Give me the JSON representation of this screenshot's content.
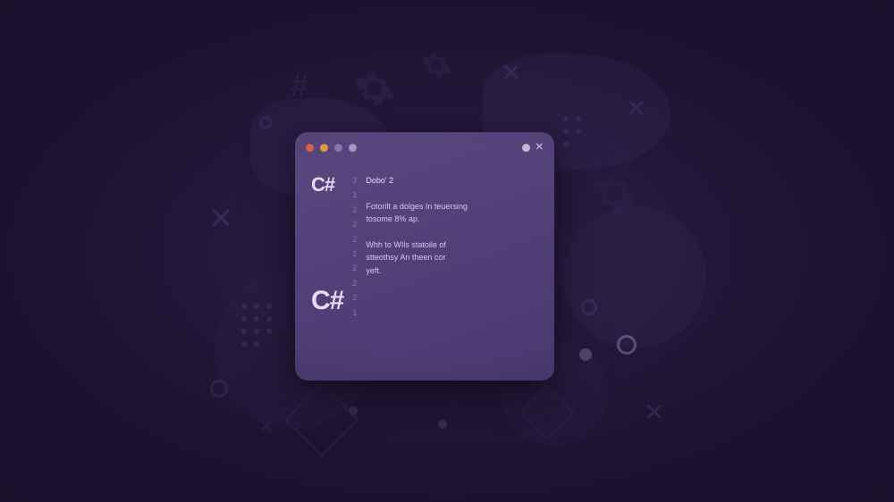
{
  "window": {
    "close_label": "×",
    "lang_badge_top": "C#",
    "lang_badge_bottom": "C#",
    "gutter": [
      "3",
      "1",
      "2",
      "2",
      "2",
      "1",
      "2",
      "2",
      "2",
      "1"
    ],
    "code_lines": [
      "Dobo' 2",
      "",
      "Fotorilt a dolges In teuersing",
      "tosome 8% ap.",
      "",
      "Whh to WIls statoile of",
      "stteothsy An theen cor",
      "yeft."
    ]
  }
}
